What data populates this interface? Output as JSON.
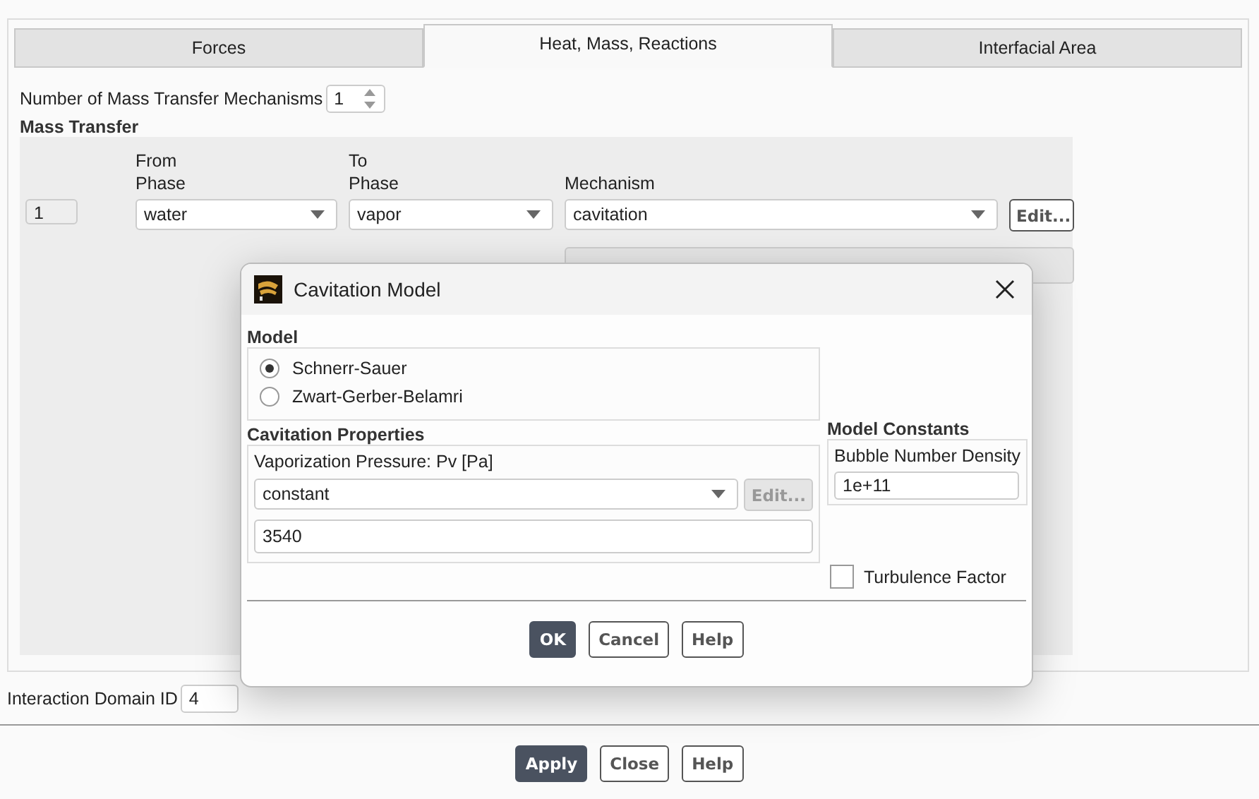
{
  "tabs": [
    {
      "label": "Forces",
      "selected": false
    },
    {
      "label": "Heat, Mass, Reactions",
      "selected": true
    },
    {
      "label": "Interfacial Area",
      "selected": false
    }
  ],
  "mechanisms_count": {
    "label": "Number of Mass Transfer Mechanisms",
    "value": "1"
  },
  "mass_transfer": {
    "title": "Mass Transfer",
    "columns": [
      "From\nPhase",
      "To\nPhase",
      "Mechanism"
    ],
    "rows": [
      {
        "index": "1",
        "from": "water",
        "to": "vapor",
        "mechanism": "cavitation",
        "edit": "Edit..."
      }
    ]
  },
  "interaction_domain": {
    "label": "Interaction Domain ID",
    "value": "4"
  },
  "buttons": [
    {
      "label": "Apply",
      "primary": true
    },
    {
      "label": "Close",
      "primary": false
    },
    {
      "label": "Help",
      "primary": false
    }
  ],
  "dialog": {
    "title": "Cavitation Model",
    "model": {
      "title": "Model",
      "options": [
        {
          "label": "Schnerr-Sauer",
          "selected": true
        },
        {
          "label": "Zwart-Gerber-Belamri",
          "selected": false
        }
      ]
    },
    "properties": {
      "title": "Cavitation Properties",
      "label": "Vaporization Pressure: Pv [Pa]",
      "method": "constant",
      "edit": {
        "label": "Edit...",
        "disabled": true
      },
      "value": "3540"
    },
    "constants": {
      "title": "Model Constants",
      "label": "Bubble Number Density",
      "value": "1e+11"
    },
    "turbulence_factor": {
      "label": "Turbulence Factor",
      "checked": false
    },
    "buttons": [
      {
        "label": "OK",
        "primary": true
      },
      {
        "label": "Cancel",
        "primary": false
      },
      {
        "label": "Help",
        "primary": false
      }
    ]
  }
}
